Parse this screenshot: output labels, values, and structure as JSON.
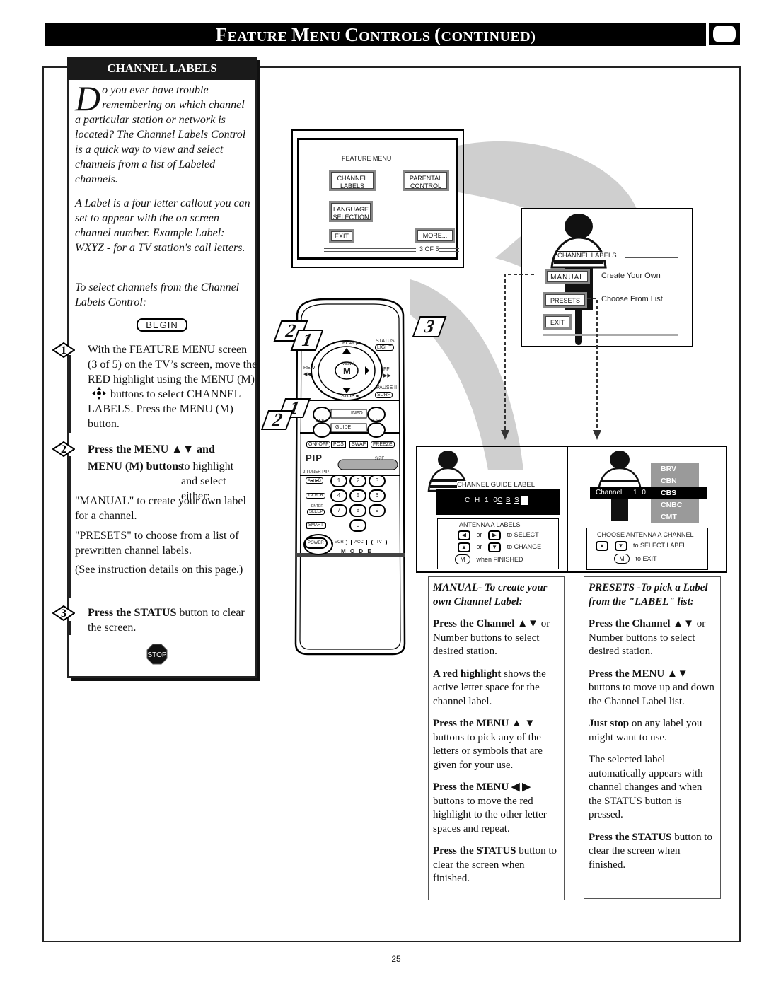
{
  "header": {
    "title_parts": [
      {
        "cap": "F",
        "rest": "EATURE "
      },
      {
        "cap": "M",
        "rest": "ENU "
      },
      {
        "cap": "C",
        "rest": "ONTROLS "
      },
      {
        "cap": "(",
        "rest": "CONTINUED)"
      }
    ],
    "icon": "tv-icon"
  },
  "section": {
    "tab_label": "CHANNEL LABELS",
    "intro_dropcap": "D",
    "intro_rest": "o you ever have trouble remembering on which channel a particular station or network is located? The Channel Labels Control is a quick way to view and select channels from a list of Labeled channels.",
    "label_para": "A Label is a four letter callout you can set to appear with the on screen channel number. Example Label: WXYZ - for a TV station's call letters.",
    "select_para": "To select channels from the Channel Labels Control:",
    "begin_label": "BEGIN",
    "steps": [
      {
        "num": "1",
        "lead": "",
        "text_a": "With the FEATURE MENU screen (3 of 5) on the TV’s screen, move the RED highlight using the MENU (M)",
        "text_b": "buttons to select CHANNEL LABELS. Press the MENU (M) button."
      },
      {
        "num": "2",
        "lead": "Press the MENU ▲▼ and MENU (M) buttons",
        "text_a": " to highlight and select either:",
        "manual": "\"MANUAL\" to create your own label for a channel.",
        "presets": "\"PRESETS\" to choose from a list of prewritten channel labels.",
        "see": "(See instruction details on this page.)"
      },
      {
        "num": "3",
        "lead": "Press the STATUS",
        "text_a": " button to clear the screen."
      }
    ],
    "stop_label": "STOP"
  },
  "feature_menu_screen": {
    "title": "FEATURE MENU",
    "buttons": {
      "channel_labels": "CHANNEL\nLABELS",
      "parental": "PARENTAL\nCONTROL",
      "language": "LANGUAGE\nSELECTION",
      "exit": "EXIT",
      "more": "MORE..."
    },
    "channel_labels_l1": "CHANNEL",
    "channel_labels_l2": "LABELS",
    "parental_l1": "PARENTAL",
    "parental_l2": "CONTROL",
    "language_l1": "LANGUAGE",
    "language_l2": "SELECTION",
    "page": "3 OF 5"
  },
  "channel_labels_screen": {
    "title": "CHANNEL LABELS",
    "manual": "MANUAL",
    "manual_desc": "Create Your Own",
    "presets": "PRESETS",
    "presets_desc": "Choose From List",
    "exit": "EXIT"
  },
  "remote": {
    "callouts": [
      "2",
      "1",
      "1",
      "2",
      "3"
    ],
    "labels": {
      "play": "PLAY ▶",
      "status": "STATUS",
      "light": "LIGHT",
      "rew": "REW",
      "rew_sym": "◀◀",
      "ff": "FF",
      "ff_sym": "▶▶",
      "menu_small": "MENU",
      "menu": "M",
      "pause": "PAUSE II",
      "surf": "SURF",
      "stop": "STOP ■",
      "info": "INFO",
      "vol": "VOL",
      "ch": "CH",
      "guide": "GUIDE",
      "on_off": "ON/ OFF",
      "pos": "POS",
      "swap": "SWAP",
      "freeze": "FREEZE",
      "pip": "PIP",
      "size": "SIZE",
      "tuner_pip": "2 TUNER PIP",
      "ab": "A◀ ▶B",
      "tv_vcr": "TV VCR",
      "enter": "ENTER",
      "sleep": "SLEEP",
      "smart": "SMART",
      "power": "POWER",
      "vcr": "VCR",
      "acc": "ACC",
      "tv": "TV",
      "mode": "M O D E"
    },
    "digits": [
      "1",
      "2",
      "3",
      "4",
      "5",
      "6",
      "7",
      "8",
      "9",
      "0"
    ]
  },
  "manual_screen": {
    "title": "CHANNEL GUIDE LABEL",
    "ch_text": "C H  1 0",
    "letters": [
      "C",
      "B",
      "S"
    ],
    "box_title": "ANTENNA A LABELS",
    "row1_or": "or",
    "row1": "to SELECT",
    "row2_or": "or",
    "row2": "to CHANGE",
    "m": "M",
    "row3": "when FINISHED"
  },
  "presets_screen": {
    "labels": [
      "BRV",
      "CBN",
      "CBS",
      "CNBC",
      "CMT"
    ],
    "selected_index": 2,
    "channel_text": "Channel",
    "channel_num": "1 0",
    "box_title": "CHOOSE ANTENNA A CHANNEL",
    "row1": "to SELECT LABEL",
    "m": "M",
    "row2": "to EXIT"
  },
  "manual_text": {
    "heading": "MANUAL- To create your own Channel Label:",
    "p1_b": "Press the Channel ▲▼",
    "p1": " or Number buttons to select desired station.",
    "p2_b": "A red highlight",
    "p2": " shows the active letter space for the channel label.",
    "p3_b": "Press the MENU ▲ ▼",
    "p3": " buttons to pick any of the letters or symbols that are given for your use.",
    "p4_b": "Press the MENU ◀ ▶",
    "p4": " buttons to move the red highlight to the other letter spaces and repeat.",
    "p5_b": "Press the STATUS",
    "p5": " button to clear the screen when finished."
  },
  "presets_text": {
    "heading": "PRESETS -To pick a Label from the \"LABEL\" list:",
    "p1_b": "Press the Channel ▲▼",
    "p1": " or Number buttons to select desired station.",
    "p2_b": "Press the MENU ▲▼",
    "p2": " buttons to move up and down the Channel Label list.",
    "p3_b": "Just stop",
    "p3": " on any label you might want to use.",
    "p4": "The selected label automatically appears with channel changes and when the STATUS button is pressed.",
    "p5_b": "Press the STATUS",
    "p5": " button to clear the screen when finished."
  },
  "page_number": "25"
}
